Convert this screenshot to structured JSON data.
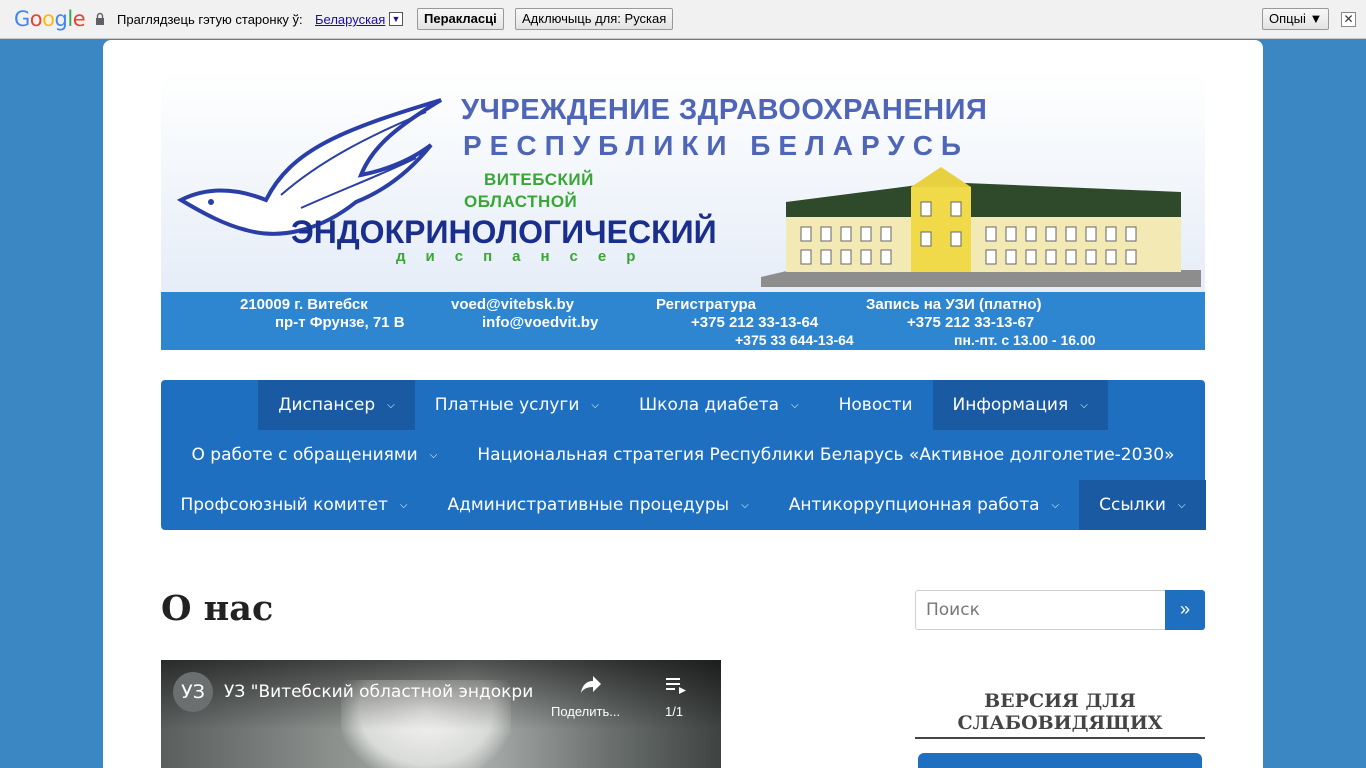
{
  "translate_bar": {
    "logo": "Google",
    "prompt": "Праглядзець гэтую старонку ў:",
    "language": "Беларуская",
    "translate_button": "Перакласці",
    "disable_button": "Адключыць для: Руская",
    "options_button": "Опцыі ▼",
    "close": "✕"
  },
  "banner": {
    "title_line1": "УЧРЕЖДЕНИЕ ЗДРАВООХРАНЕНИЯ",
    "title_line2": "РЕСПУБЛИКИ БЕЛАРУСЬ",
    "region_line1": "ВИТЕБСКИЙ",
    "region_line2": "ОБЛАСТНОЙ",
    "main_name": "ЭНДОКРИНОЛОГИЧЕСКИЙ",
    "sub_name": "диспансер",
    "address_line1": "210009 г. Витебск",
    "address_line2": "пр-т Фрунзе, 71 В",
    "email1": "voed@vitebsk.by",
    "email2": "info@voedvit.by",
    "registry_label": "Регистратура",
    "registry_phone1": "+375 212 33-13-64",
    "registry_phone2": "+375 33 644-13-64",
    "uzi_label": "Запись на УЗИ (платно)",
    "uzi_phone": "+375 212 33-13-67",
    "uzi_hours": "пн.-пт. с 13.00 - 16.00"
  },
  "nav": {
    "row1": [
      {
        "label": "Диспансер",
        "caret": true,
        "active": true
      },
      {
        "label": "Платные услуги",
        "caret": true,
        "active": false
      },
      {
        "label": "Школа диабета",
        "caret": true,
        "active": false
      },
      {
        "label": "Новости",
        "caret": false,
        "active": false
      },
      {
        "label": "Информация",
        "caret": true,
        "active": true
      }
    ],
    "row2": [
      {
        "label": "О работе с обращениями",
        "caret": true,
        "active": false
      },
      {
        "label": "Национальная стратегия Республики Беларусь «Активное долголетие-2030»",
        "caret": false,
        "active": false
      }
    ],
    "row3": [
      {
        "label": "Профсоюзный комитет",
        "caret": true,
        "active": false
      },
      {
        "label": "Административные процедуры",
        "caret": true,
        "active": false
      },
      {
        "label": "Антикоррупционная работа",
        "caret": true,
        "active": false
      },
      {
        "label": "Ссылки",
        "caret": true,
        "active": true
      }
    ]
  },
  "main": {
    "page_title": "О нас",
    "video": {
      "channel_avatar": "УЗ",
      "title": "УЗ \"Витебский областной эндокрин...",
      "share_label": "Поделить...",
      "playlist_count": "1/1"
    }
  },
  "sidebar": {
    "search_placeholder": "Поиск",
    "search_button": "»",
    "widget_title": "ВЕРСИЯ ДЛЯ СЛАБОВИДЯЩИХ"
  },
  "colors": {
    "background": "#3a87c4",
    "nav": "#1f6fc1",
    "nav_active": "#195aa3",
    "banner_strip": "#2e85d0"
  }
}
